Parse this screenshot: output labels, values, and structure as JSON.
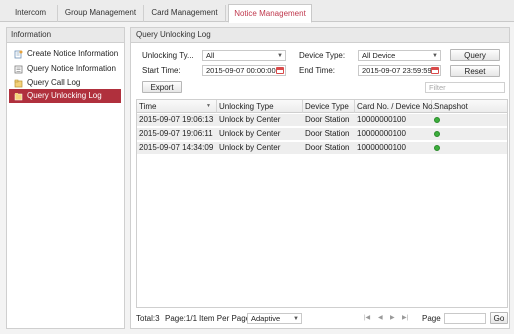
{
  "tabs": [
    {
      "label": "Intercom"
    },
    {
      "label": "Group Management"
    },
    {
      "label": "Card Management"
    },
    {
      "label": "Notice Management"
    }
  ],
  "sidebar": {
    "title": "Information",
    "items": [
      {
        "label": "Create Notice Information",
        "icon": "create-notice-icon"
      },
      {
        "label": "Query Notice Information",
        "icon": "query-notice-icon"
      },
      {
        "label": "Query Call Log",
        "icon": "call-log-icon"
      },
      {
        "label": "Query Unlocking Log",
        "icon": "unlock-log-icon"
      }
    ]
  },
  "main": {
    "title": "Query Unlocking Log",
    "unlocking_type_label": "Unlocking Ty...",
    "unlocking_type_value": "All",
    "device_type_label": "Device Type:",
    "device_type_value": "All Device",
    "start_time_label": "Start Time:",
    "start_time_value": "2015-09-07 00:00:00",
    "end_time_label": "End Time:",
    "end_time_value": "2015-09-07 23:59:59",
    "query_label": "Query",
    "reset_label": "Reset",
    "export_label": "Export",
    "filter_placeholder": "Filter"
  },
  "table": {
    "columns": [
      "Time",
      "Unlocking Type",
      "Device Type",
      "Card No. / Device No.",
      "Snapshot"
    ],
    "rows": [
      [
        "2015-09-07 19:06:13",
        "Unlock by Center",
        "Door Station",
        "10000000100"
      ],
      [
        "2015-09-07 19:06:11",
        "Unlock by Center",
        "Door Station",
        "10000000100"
      ],
      [
        "2015-09-07 14:34:09",
        "Unlock by Center",
        "Door Station",
        "10000000100"
      ]
    ]
  },
  "footer": {
    "total": "Total:3",
    "page_info": "Page:1/1",
    "per_page_label": "Item Per Page:",
    "per_page_value": "Adaptive",
    "page_label": "Page",
    "go_label": "Go"
  },
  "colors": {
    "accent": "#b0303d",
    "active_tab_text": "#c0384d",
    "snapshot_ok": "#3cae3c"
  }
}
